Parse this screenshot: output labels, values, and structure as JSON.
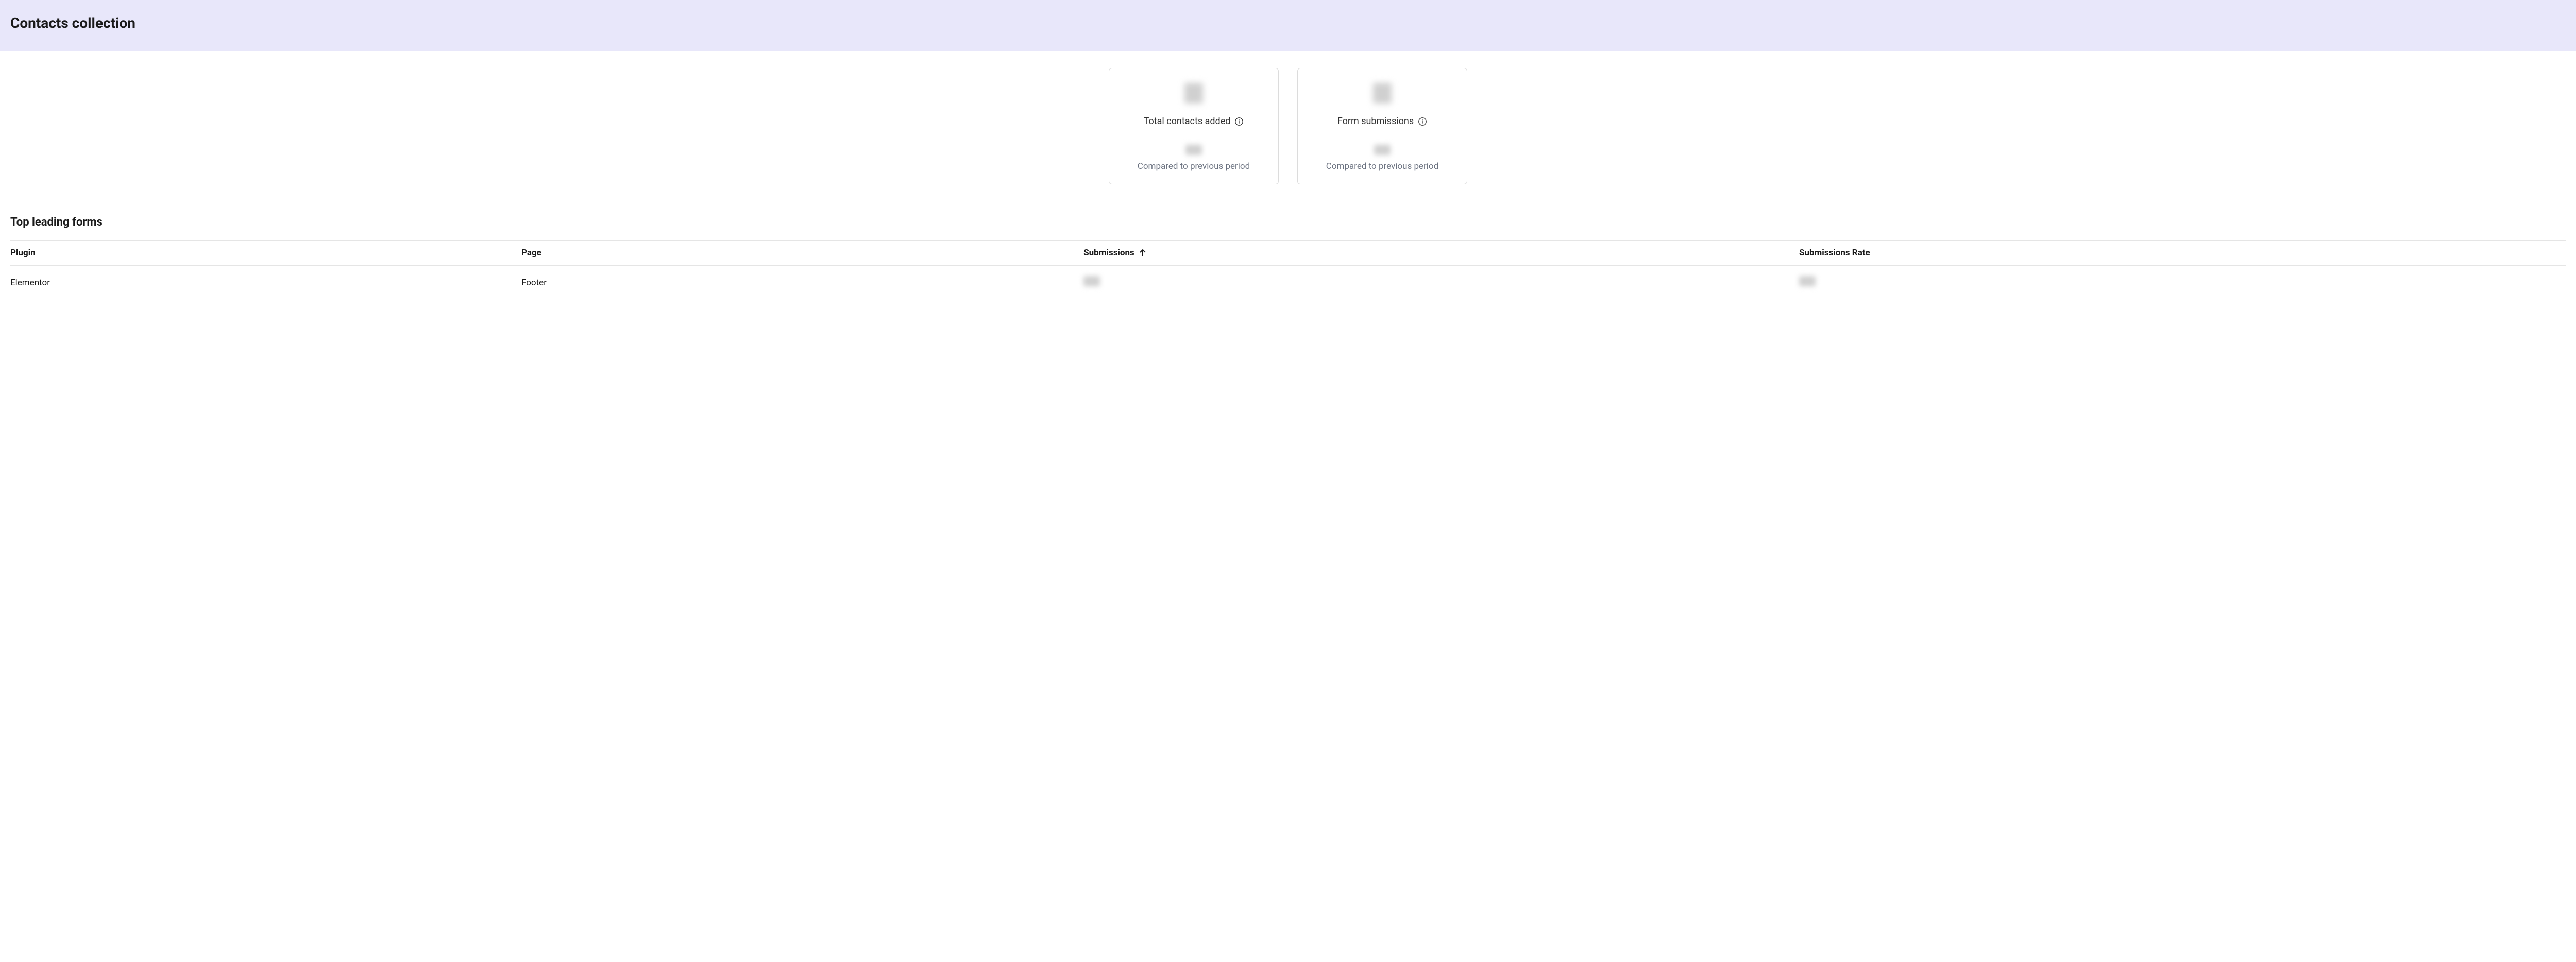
{
  "header": {
    "title": "Contacts collection"
  },
  "stats": {
    "card1": {
      "label": "Total contacts added",
      "compared_text": "Compared to previous period"
    },
    "card2": {
      "label": "Form submissions",
      "compared_text": "Compared to previous period"
    }
  },
  "table": {
    "title": "Top leading forms",
    "headers": {
      "plugin": "Plugin",
      "page": "Page",
      "submissions": "Submissions",
      "rate": "Submissions Rate"
    },
    "rows": [
      {
        "plugin": "Elementor",
        "page": "Footer"
      }
    ]
  }
}
